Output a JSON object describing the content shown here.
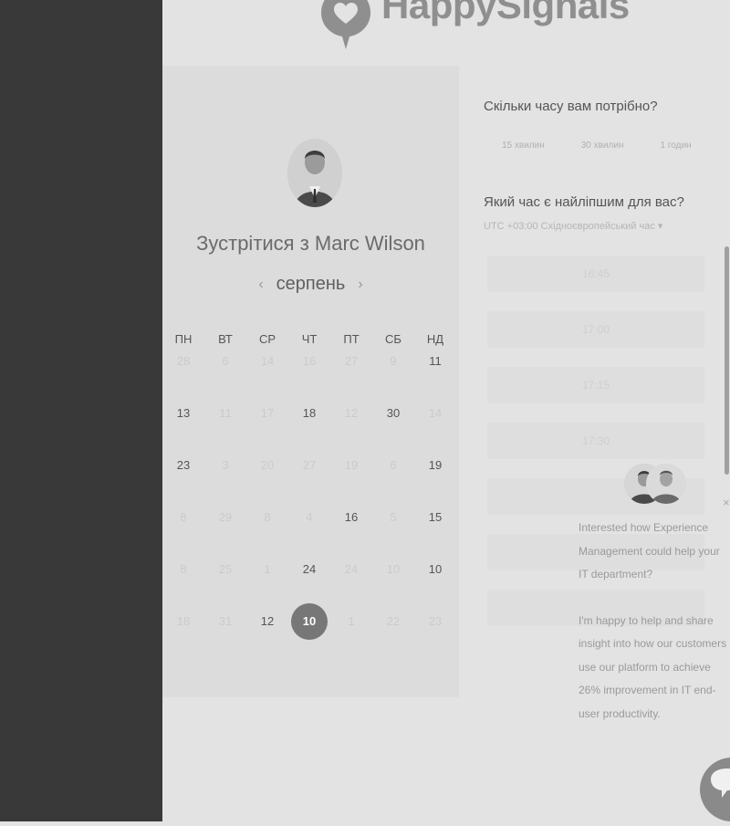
{
  "brand": {
    "name": "HappySignals"
  },
  "calendar": {
    "title": "Зустрітися з Marc Wilson",
    "month": "серпень",
    "prev_icon": "chevron-left-icon",
    "next_icon": "chevron-right-icon",
    "weekdays": [
      "ПН",
      "ВТ",
      "СР",
      "ЧТ",
      "ПТ",
      "СБ",
      "НД"
    ],
    "rows": [
      [
        "28",
        "6",
        "14",
        "16",
        "27",
        "9",
        "11"
      ],
      [
        "13",
        "11",
        "17",
        "18",
        "12",
        "30",
        "14"
      ],
      [
        "23",
        "3",
        "20",
        "27",
        "19",
        "6",
        "19"
      ],
      [
        "8",
        "29",
        "8",
        "4",
        "16",
        "5",
        "15"
      ],
      [
        "8",
        "25",
        "1",
        "24",
        "24",
        "10",
        "10"
      ],
      [
        "18",
        "31",
        "12",
        "10",
        "1",
        "22",
        "23"
      ]
    ],
    "available": [
      [
        0,
        6
      ],
      [
        1,
        0
      ],
      [
        1,
        3
      ],
      [
        1,
        5
      ],
      [
        2,
        0
      ],
      [
        2,
        6
      ],
      [
        3,
        4
      ],
      [
        3,
        6
      ],
      [
        4,
        3
      ],
      [
        4,
        6
      ],
      [
        5,
        2
      ]
    ],
    "selected": [
      5,
      3
    ]
  },
  "duration": {
    "question": "Скільки часу вам потрібно?",
    "options": [
      "15 хвилин",
      "30 хвилин",
      "1 годин"
    ]
  },
  "time": {
    "question": "Який час є найліпшим для вас?",
    "timezone": "UTC +03:00 Східноєвропейський час",
    "slots": [
      "16:45",
      "17:00",
      "17:15",
      "17:30",
      "",
      "",
      ""
    ]
  },
  "chat": {
    "message1": "Interested how Experience Management could help your IT department?",
    "message2": "I'm happy to help and share insight into how our customers use our platform to achieve 26% improvement in IT end-user productivity.",
    "close": "×"
  }
}
